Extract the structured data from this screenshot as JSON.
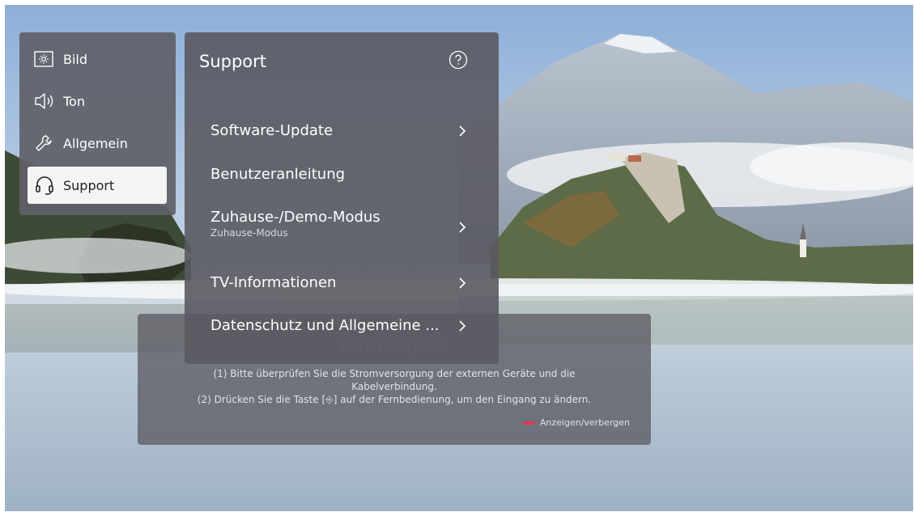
{
  "categories": [
    {
      "label": "Bild",
      "icon": "picture-icon",
      "active": false
    },
    {
      "label": "Ton",
      "icon": "speaker-icon",
      "active": false
    },
    {
      "label": "Allgemein",
      "icon": "wrench-icon",
      "active": false
    },
    {
      "label": "Support",
      "icon": "headset-icon",
      "active": true
    }
  ],
  "support": {
    "title": "Support",
    "help_icon": "help-icon",
    "items": [
      {
        "label": "Software-Update",
        "sub": "",
        "chevron": true
      },
      {
        "label": "Benutzeranleitung",
        "sub": "",
        "chevron": false
      },
      {
        "label": "Zuhause-/Demo-Modus",
        "sub": "Zuhause-Modus",
        "chevron": true
      },
      {
        "label": "TV-Informationen",
        "sub": "",
        "chevron": true
      },
      {
        "label": "Datenschutz und Allgemeine ...",
        "sub": "",
        "chevron": true
      }
    ]
  },
  "signal": {
    "title": "Kein Signal",
    "line1": "(1) Bitte überprüfen Sie die Stromversorgung der externen Geräte und die",
    "line2": "Kabelverbindung.",
    "line3": "(2) Drücken Sie die Taste [⎆] auf der Fernbedienung, um den Eingang zu ändern.",
    "hint": "Anzeigen/verbergen",
    "hint_key_color": "#e0384f"
  }
}
